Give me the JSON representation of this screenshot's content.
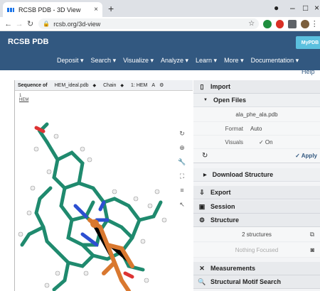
{
  "browser": {
    "tab_title": "RCSB PDB - 3D View",
    "tab_close": "×",
    "new_tab": "+",
    "url": "rcsb.org/3d-view",
    "win_min": "–",
    "win_max": "□",
    "win_close": "×"
  },
  "site": {
    "brand": "RCSB PDB",
    "mypdb": "MyPDB",
    "menu": [
      "Deposit ▾",
      "Search ▾",
      "Visualize ▾",
      "Analyze ▾",
      "Learn ▾",
      "More ▾",
      "Documentation ▾"
    ],
    "help": "Help"
  },
  "sequence": {
    "label": "Sequence of",
    "entry": "HEM_ideal.pdb",
    "mode": "Chain",
    "chain": "1: HEM",
    "res_index": "1",
    "res_name": "HEM",
    "extra": "A"
  },
  "panel": {
    "import": "Import",
    "open_files": "Open Files",
    "file_name": "ala_phe_ala.pdb",
    "format_label": "Format",
    "format_value": "Auto",
    "visuals_label": "Visuals",
    "visuals_value": "✓ On",
    "apply": "✓ Apply",
    "download": "Download Structure",
    "export": "Export",
    "session": "Session",
    "structure": "Structure",
    "structures_count": "2 structures",
    "nothing_focused": "Nothing Focused",
    "measurements": "Measurements",
    "motif_search": "Structural Motif Search"
  },
  "colors": {
    "header_bg": "#325880",
    "mypdb_bg": "#5bc0de",
    "carbon": "#1f8a6e",
    "nitrogen": "#2c4fd1",
    "oxygen": "#d33",
    "iron": "#d9782f"
  }
}
